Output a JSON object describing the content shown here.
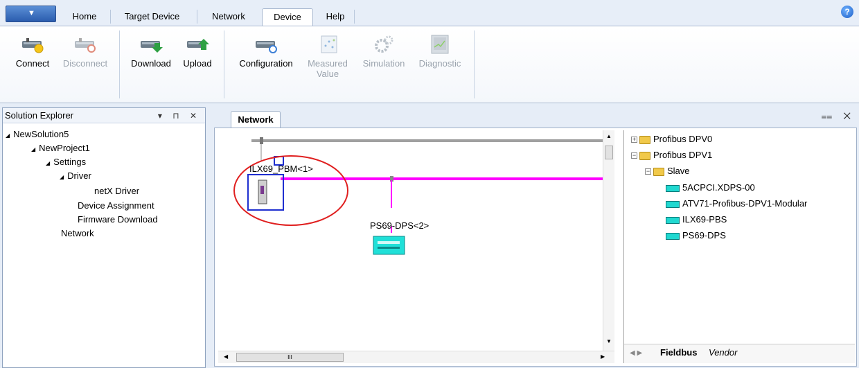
{
  "menu": {
    "app_button_glyph": "▼",
    "tabs": [
      {
        "label": "Home"
      },
      {
        "label": "Target Device"
      },
      {
        "label": "Network"
      },
      {
        "label": "Device",
        "active": true
      },
      {
        "label": "Help"
      }
    ],
    "help_glyph": "?"
  },
  "ribbon": {
    "connect": "Connect",
    "disconnect": "Disconnect",
    "download": "Download",
    "upload": "Upload",
    "configuration": "Configuration",
    "measured_value_1": "Measured",
    "measured_value_2": "Value",
    "simulation": "Simulation",
    "diagnostic": "Diagnostic"
  },
  "explorer": {
    "title": "Solution Explorer",
    "controls": "▾ ⊓ ✕",
    "tree": [
      {
        "label": "NewSolution5",
        "arrow": "◢"
      },
      {
        "label": "NewProject1",
        "arrow": "◢"
      },
      {
        "label": "Settings",
        "arrow": "◢"
      },
      {
        "label": "Driver",
        "arrow": "◢"
      },
      {
        "label": "netX Driver",
        "arrow": ""
      },
      {
        "label": "Device Assignment",
        "arrow": ""
      },
      {
        "label": "Firmware Download",
        "arrow": ""
      },
      {
        "label": "Network",
        "arrow": ""
      }
    ]
  },
  "document": {
    "tab_label": "Network",
    "controls": "⩵ ✕",
    "devices": [
      {
        "label": "ILX69_PBM<1>"
      },
      {
        "label": "PS69-DPS<2>"
      }
    ],
    "hscroll_thumb": "III",
    "colors": {
      "bus": "#ff00ff",
      "highlight": "#e02020",
      "selection": "#1f2fd0"
    }
  },
  "catalog": {
    "folders": [
      {
        "label": "Profibus DPV0",
        "toggle": "+"
      },
      {
        "label": "Profibus DPV1",
        "toggle": "−"
      },
      {
        "label": "Slave",
        "toggle": "−"
      }
    ],
    "slaves": [
      "5ACPCI.XDPS-00",
      "ATV71-Profibus-DPV1-Modular",
      "ILX69-PBS",
      "PS69-DPS"
    ],
    "tabs": {
      "fieldbus": "Fieldbus",
      "vendor": "Vendor"
    }
  }
}
